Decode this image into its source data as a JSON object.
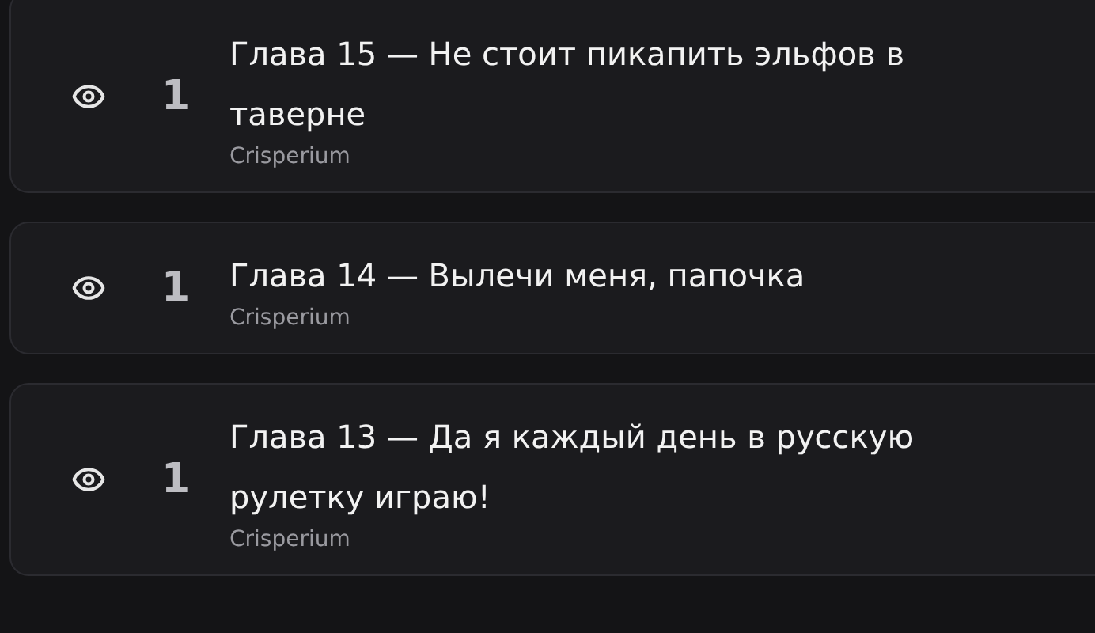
{
  "chapters": [
    {
      "views": "1",
      "title": "Глава 15 — Не стоит пикапить эльфов в таверне",
      "author": "Crisperium"
    },
    {
      "views": "1",
      "title": "Глава 14 — Вылечи меня, папочка",
      "author": "Crisperium"
    },
    {
      "views": "1",
      "title": "Глава 13 — Да я каждый день в русскую рулетку играю!",
      "author": "Crisperium"
    }
  ]
}
